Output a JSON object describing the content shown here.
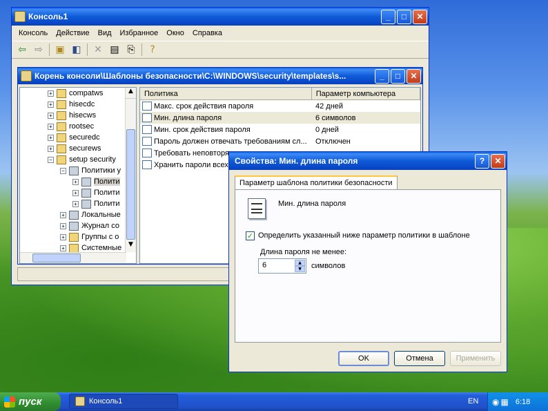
{
  "console_window": {
    "title": "Консоль1",
    "menu": [
      "Консоль",
      "Действие",
      "Вид",
      "Избранное",
      "Окно",
      "Справка"
    ],
    "child_title": "Корень консоли\\Шаблоны безопасности\\C:\\WINDOWS\\security\\templates\\s...",
    "tree": [
      "compatws",
      "hisecdc",
      "hisecws",
      "rootsec",
      "securedc",
      "securews",
      "setup security",
      "Политики у",
      "Полити",
      "Полити",
      "Полити",
      "Локальные",
      "Журнал со",
      "Группы с о",
      "Системные"
    ],
    "list_headers": [
      "Политика",
      "Параметр компьютера"
    ],
    "list_rows": [
      {
        "policy": "Макс. срок действия пароля",
        "value": "42 дней"
      },
      {
        "policy": "Мин. длина пароля",
        "value": "6 символов"
      },
      {
        "policy": "Мин. срок действия пароля",
        "value": "0 дней"
      },
      {
        "policy": "Пароль должен отвечать требованиям сл...",
        "value": "Отключен"
      },
      {
        "policy": "Требовать неповторя",
        "value": ""
      },
      {
        "policy": "Хранить пароли всех",
        "value": ""
      }
    ]
  },
  "dialog": {
    "title": "Свойства: Мин. длина пароля",
    "tab": "Параметр шаблона политики безопасности",
    "policy_name": "Мин. длина пароля",
    "checkbox_label": "Определить указанный ниже параметр политики в шаблоне",
    "length_label": "Длина пароля не менее:",
    "length_value": "6",
    "units": "символов",
    "ok": "OK",
    "cancel": "Отмена",
    "apply": "Применить",
    "help_glyph": "?"
  },
  "taskbar": {
    "start": "пуск",
    "task": "Консоль1",
    "lang": "EN",
    "clock": "6:18"
  }
}
